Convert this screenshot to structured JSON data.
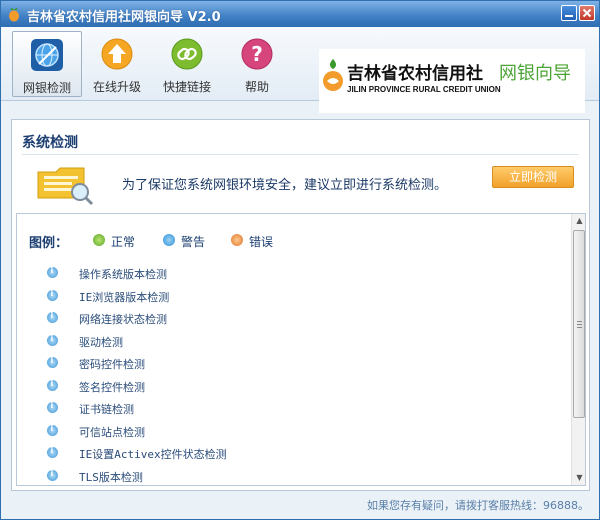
{
  "window": {
    "title": "吉林省农村信用社网银向导 V2.0",
    "accent": "#3f7fc4"
  },
  "toolbar": {
    "items": [
      {
        "label": "网银检测",
        "icon": "globe-icon",
        "active": true
      },
      {
        "label": "在线升级",
        "icon": "upgrade-arrow-icon",
        "active": false
      },
      {
        "label": "快捷链接",
        "icon": "link-icon",
        "active": false
      },
      {
        "label": "帮助",
        "icon": "help-question-icon",
        "active": false
      }
    ]
  },
  "logo": {
    "name_cn": "吉林省农村信用社",
    "name_en": "JILIN PROVINCE RURAL CREDIT UNION",
    "product": "网银向导"
  },
  "system_check": {
    "title": "系统检测",
    "advice": "为了保证您系统网银环境安全，建议立即进行系统检测。",
    "button_label": "立即检测"
  },
  "legend": {
    "title": "图例：",
    "items": [
      {
        "label": "正常",
        "color": "#5ea72b"
      },
      {
        "label": "警告",
        "color": "#2d8fd6"
      },
      {
        "label": "错误",
        "color": "#e0752c"
      }
    ]
  },
  "checks": [
    {
      "label": "操作系统版本检测",
      "status": "info"
    },
    {
      "label": "IE浏览器版本检测",
      "status": "info"
    },
    {
      "label": "网络连接状态检测",
      "status": "info"
    },
    {
      "label": "驱动检测",
      "status": "info"
    },
    {
      "label": "密码控件检测",
      "status": "info"
    },
    {
      "label": "签名控件检测",
      "status": "info"
    },
    {
      "label": "证书链检测",
      "status": "info"
    },
    {
      "label": "可信站点检测",
      "status": "info"
    },
    {
      "label": "IE设置Activex控件状态检测",
      "status": "info"
    },
    {
      "label": "TLS版本检测",
      "status": "info"
    }
  ],
  "footer": {
    "text": "如果您存有疑问，请拨打客服热线：96888。"
  }
}
